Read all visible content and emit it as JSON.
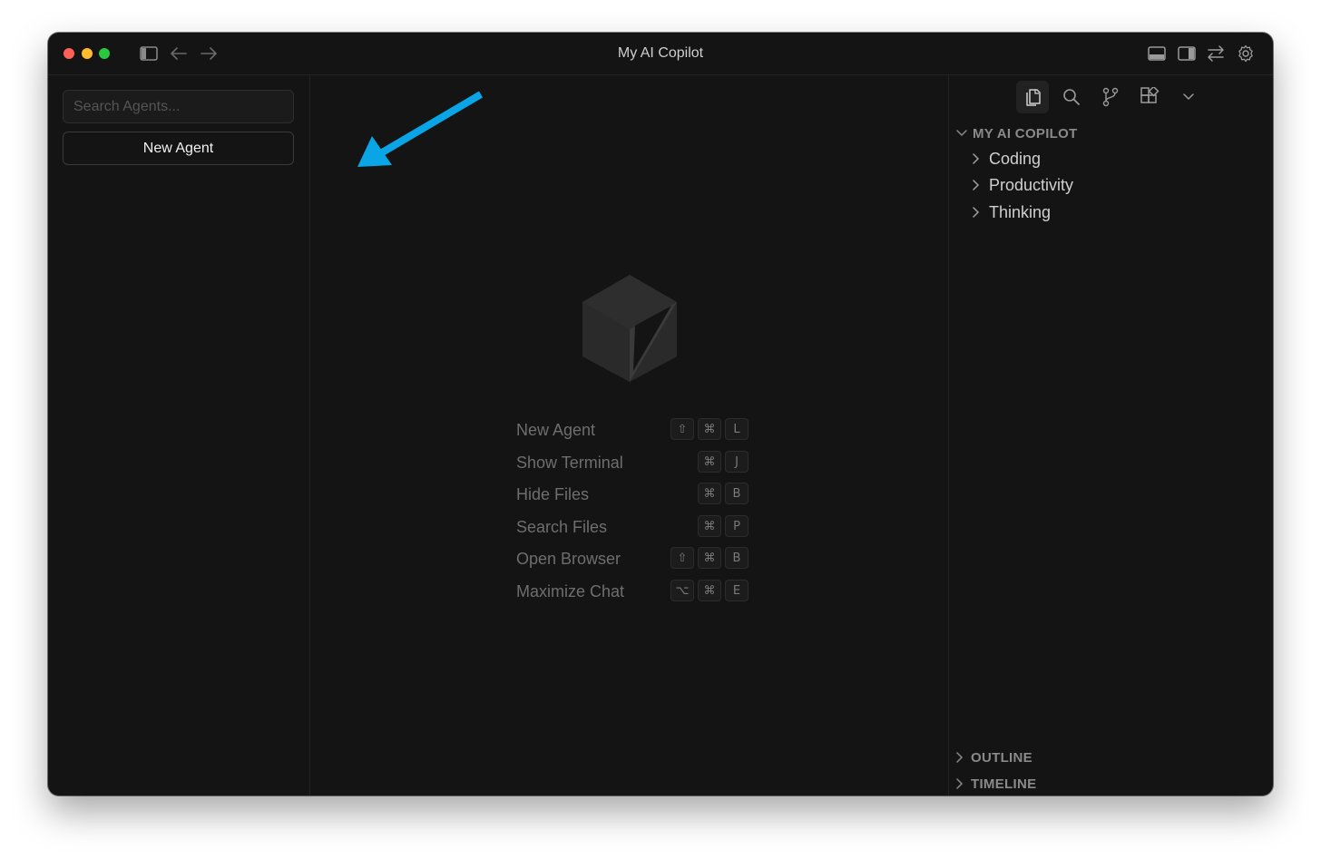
{
  "window": {
    "title": "My AI Copilot"
  },
  "left_panel": {
    "search_placeholder": "Search Agents...",
    "new_agent_label": "New Agent"
  },
  "right_panel": {
    "toolbar_icons": [
      "files-icon",
      "search-icon",
      "source-control-icon",
      "extensions-icon",
      "chevron-down-icon"
    ],
    "tree_header": "MY AI COPILOT",
    "tree_items": [
      {
        "label": "Coding"
      },
      {
        "label": "Productivity"
      },
      {
        "label": "Thinking"
      }
    ],
    "footer_sections": [
      {
        "label": "OUTLINE"
      },
      {
        "label": "TIMELINE"
      }
    ]
  },
  "shortcuts": [
    {
      "label": "New Agent",
      "keys": [
        "⇧",
        "⌘",
        "L"
      ]
    },
    {
      "label": "Show Terminal",
      "keys": [
        "⌘",
        "J"
      ]
    },
    {
      "label": "Hide Files",
      "keys": [
        "⌘",
        "B"
      ]
    },
    {
      "label": "Search Files",
      "keys": [
        "⌘",
        "P"
      ]
    },
    {
      "label": "Open Browser",
      "keys": [
        "⇧",
        "⌘",
        "B"
      ]
    },
    {
      "label": "Maximize Chat",
      "keys": [
        "⌥",
        "⌘",
        "E"
      ]
    }
  ],
  "colors": {
    "background": "#141414",
    "annotation_arrow": "#0aa5e6",
    "traffic_red": "#fe5f57",
    "traffic_yellow": "#febc2e",
    "traffic_green": "#28c840"
  }
}
